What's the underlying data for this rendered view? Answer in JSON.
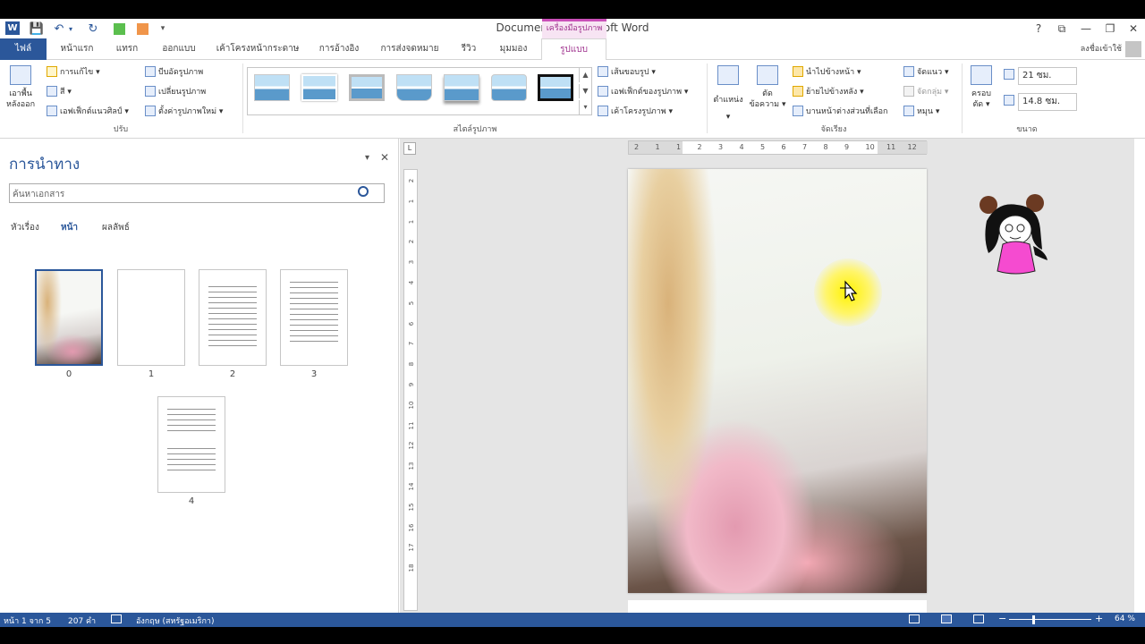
{
  "window": {
    "title": "Document1 - Microsoft Word",
    "tools_tab": "เครื่องมือรูปภาพ",
    "help": "?",
    "controls": {
      "ribbon": "⧉",
      "minimize": "—",
      "restore": "❐",
      "close": "✕"
    }
  },
  "qat": {
    "save": "💾",
    "undo": "↶",
    "undo_drop": "▾",
    "redo": "↻",
    "customize": "▾"
  },
  "tabs": [
    {
      "label": "ไฟล์"
    },
    {
      "label": "หน้าแรก"
    },
    {
      "label": "แทรก"
    },
    {
      "label": "ออกแบบ"
    },
    {
      "label": "เค้าโครงหน้ากระดาษ"
    },
    {
      "label": "การอ้างอิง"
    },
    {
      "label": "การส่งจดหมาย"
    },
    {
      "label": "รีวิว"
    },
    {
      "label": "มุมมอง"
    },
    {
      "label": "รูปแบบ"
    }
  ],
  "signin": "ลงชื่อเข้าใช้",
  "ribbon": {
    "remove_bg": "เอาพื้นหลังออก",
    "adjust": {
      "corrections": "การแก้ไข ▾",
      "color": "สี ▾",
      "artistic": "เอฟเฟ็กต์แนวศิลป์ ▾",
      "compress": "บีบอัดรูปภาพ",
      "change": "เปลี่ยนรูปภาพ",
      "reset": "ตั้งค่ารูปภาพใหม่ ▾",
      "label": "ปรับ"
    },
    "styles": {
      "label": "สไตล์รูปภาพ",
      "border": "เส้นขอบรูป ▾",
      "effects": "เอฟเฟ็กต์ของรูปภาพ ▾",
      "layout": "เค้าโครงรูปภาพ ▾",
      "up": "▲",
      "down": "▼",
      "more": "▾"
    },
    "arrange": {
      "position": "ตำแหน่ง ▾",
      "wrap": "ตัดข้อความ ▾",
      "forward": "นำไปข้างหน้า ▾",
      "backward": "ย้ายไปข้างหลัง ▾",
      "pane": "บานหน้าต่างส่วนที่เลือก",
      "align": "จัดแนว ▾",
      "group": "จัดกลุ่ม ▾",
      "rotate": "หมุน ▾",
      "label": "จัดเรียง"
    },
    "size": {
      "crop": "ครอบตัด ▾",
      "height": "21 ซม.",
      "width": "14.8 ซม.",
      "label": "ขนาด"
    }
  },
  "nav": {
    "title": "การนำทาง",
    "search_placeholder": "ค้นหาเอกสาร",
    "tabs": [
      "หัวเรื่อง",
      "หน้า",
      "ผลลัพธ์"
    ],
    "pages": [
      "0",
      "1",
      "2",
      "3",
      "4"
    ],
    "close": "✕",
    "menu": "▾"
  },
  "ruler": {
    "h_ticks": [
      "2",
      "1",
      "1",
      "2",
      "3",
      "4",
      "5",
      "6",
      "7",
      "8",
      "9",
      "10",
      "11",
      "12"
    ],
    "v_ticks": [
      "2",
      "1",
      "1",
      "2",
      "3",
      "4",
      "5",
      "6",
      "7",
      "8",
      "9",
      "10",
      "11",
      "12",
      "13",
      "14",
      "15",
      "16",
      "17",
      "18"
    ],
    "corner": "L"
  },
  "status": {
    "page": "หน้า 1 จาก 5",
    "words": "207 คำ",
    "language": "อังกฤษ (สหรัฐอเมริกา)",
    "zoom": "64 %",
    "zoom_minus": "−",
    "zoom_plus": "+"
  }
}
